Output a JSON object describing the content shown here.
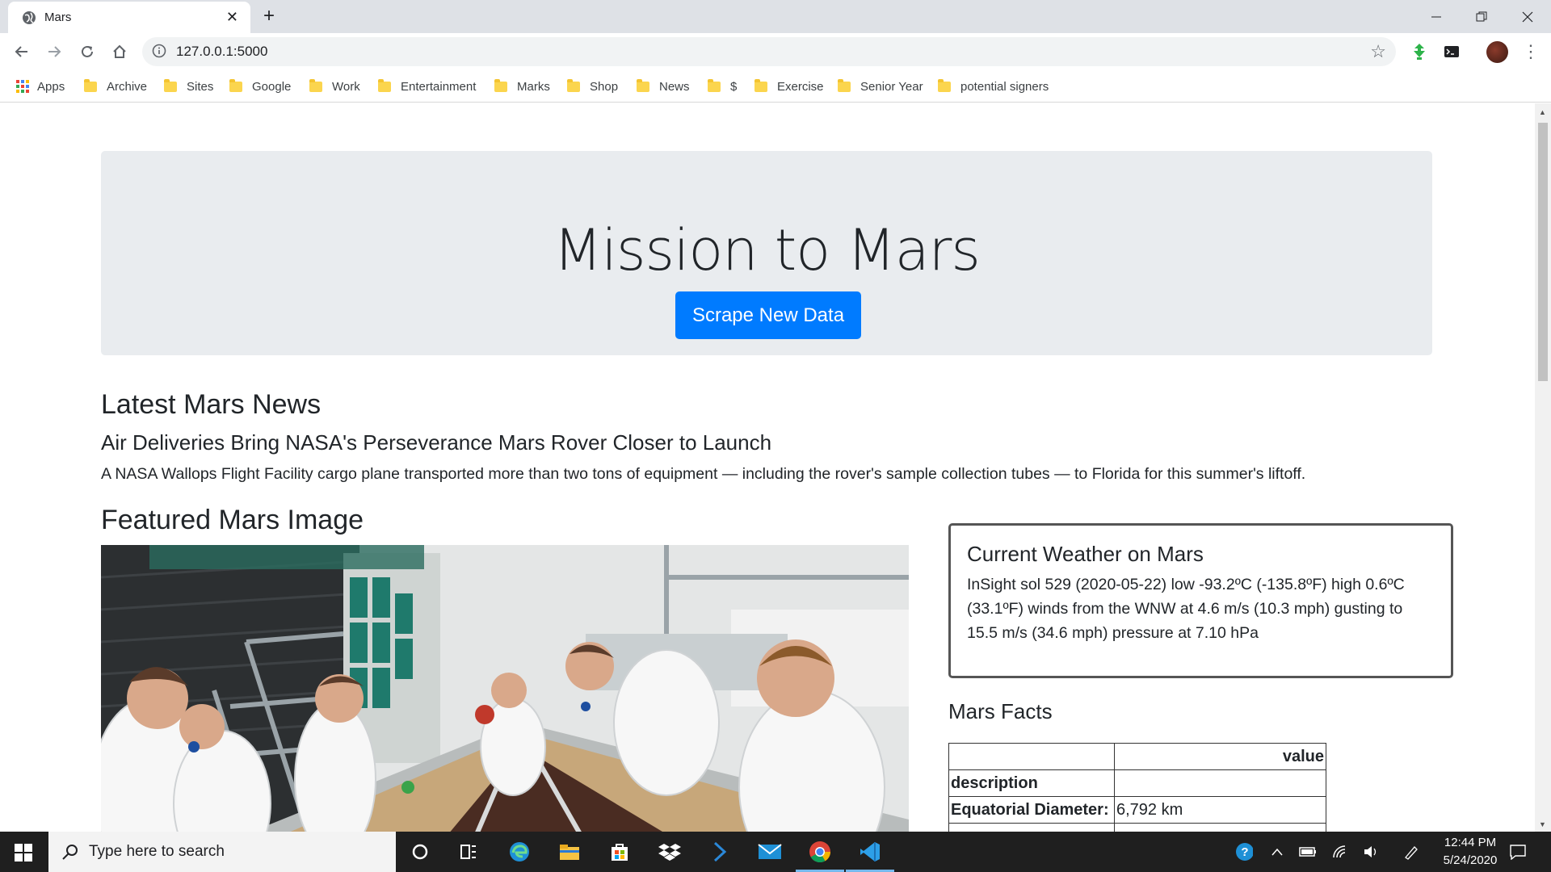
{
  "browser": {
    "tab_title": "Mars",
    "url": "127.0.0.1:5000",
    "bookmarks": [
      "Apps",
      "Archive",
      "Sites",
      "Google",
      "Work",
      "Entertainment",
      "Marks",
      "Shop",
      "News",
      "$",
      "Exercise",
      "Senior Year",
      "potential signers"
    ]
  },
  "page": {
    "title": "Mission to Mars",
    "scrape_button": "Scrape New Data",
    "news_heading": "Latest Mars News",
    "news_title": "Air Deliveries Bring NASA's Perseverance Mars Rover Closer to Launch",
    "news_paragraph": "A NASA Wallops Flight Facility cargo plane transported more than two tons of equipment — including the rover's sample collection tubes — to Florida for this summer's liftoff.",
    "featured_heading": "Featured Mars Image",
    "weather_heading": "Current Weather on Mars",
    "weather_text": "InSight sol 529 (2020-05-22) low -93.2ºC (-135.8ºF) high 0.6ºC (33.1ºF) winds from the WNW at 4.6 m/s (10.3 mph) gusting to 15.5 m/s (34.6 mph) pressure at 7.10 hPa",
    "facts_heading": "Mars Facts",
    "facts_table": {
      "header": "value",
      "index_label": "description",
      "rows": [
        {
          "key": "Equatorial Diameter:",
          "value": "6,792 km"
        }
      ]
    }
  },
  "taskbar": {
    "search_placeholder": "Type here to search",
    "time": "12:44 PM",
    "date": "5/24/2020"
  },
  "colors": {
    "primary_button": "#007bff",
    "jumbotron_bg": "#e9ecef",
    "taskbar_bg": "#1f1f1f"
  }
}
